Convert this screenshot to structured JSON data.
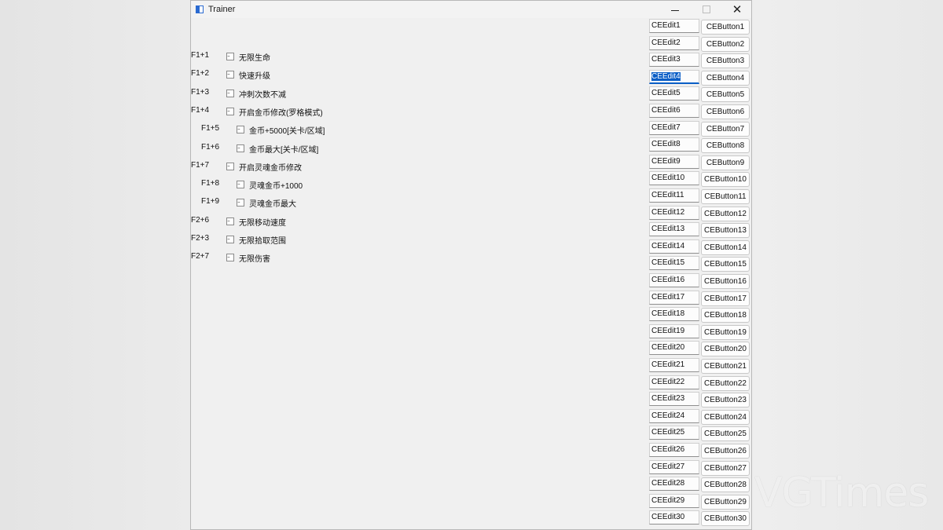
{
  "window": {
    "title": "Trainer",
    "controls": {
      "minimize": "—",
      "maximize": "☐",
      "close": "✕"
    }
  },
  "options": [
    {
      "hotkey": "F1+1",
      "label": "无限生命",
      "indent": false
    },
    {
      "hotkey": "F1+2",
      "label": "快速升级",
      "indent": false
    },
    {
      "hotkey": "F1+3",
      "label": "冲刺次数不减",
      "indent": false
    },
    {
      "hotkey": "F1+4",
      "label": "开启金币修改(罗格模式)",
      "indent": false
    },
    {
      "hotkey": "F1+5",
      "label": "金币+5000[关卡/区域]",
      "indent": true
    },
    {
      "hotkey": "F1+6",
      "label": "金币最大[关卡/区域]",
      "indent": true
    },
    {
      "hotkey": "F1+7",
      "label": "开启灵魂金币修改",
      "indent": false
    },
    {
      "hotkey": "F1+8",
      "label": "灵魂金币+1000",
      "indent": true
    },
    {
      "hotkey": "F1+9",
      "label": "灵魂金币最大",
      "indent": true
    },
    {
      "hotkey": "F2+6",
      "label": "无限移动速度",
      "indent": false
    },
    {
      "hotkey": "F2+3",
      "label": "无限拾取范围",
      "indent": false
    },
    {
      "hotkey": "F2+7",
      "label": "无限伤害",
      "indent": false
    }
  ],
  "edits": [
    "CEEdit1",
    "CEEdit2",
    "CEEdit3",
    "CEEdit4",
    "CEEdit5",
    "CEEdit6",
    "CEEdit7",
    "CEEdit8",
    "CEEdit9",
    "CEEdit10",
    "CEEdit11",
    "CEEdit12",
    "CEEdit13",
    "CEEdit14",
    "CEEdit15",
    "CEEdit16",
    "CEEdit17",
    "CEEdit18",
    "CEEdit19",
    "CEEdit20",
    "CEEdit21",
    "CEEdit22",
    "CEEdit23",
    "CEEdit24",
    "CEEdit25",
    "CEEdit26",
    "CEEdit27",
    "CEEdit28",
    "CEEdit29",
    "CEEdit30"
  ],
  "buttons": [
    "CEButton1",
    "CEButton2",
    "CEButton3",
    "CEButton4",
    "CEButton5",
    "CEButton6",
    "CEButton7",
    "CEButton8",
    "CEButton9",
    "CEButton10",
    "CEButton11",
    "CEButton12",
    "CEButton13",
    "CEButton14",
    "CEButton15",
    "CEButton16",
    "CEButton17",
    "CEButton18",
    "CEButton19",
    "CEButton20",
    "CEButton21",
    "CEButton22",
    "CEButton23",
    "CEButton24",
    "CEButton25",
    "CEButton26",
    "CEButton27",
    "CEButton28",
    "CEButton29",
    "CEButton30"
  ],
  "active_edit": "CEEdit4",
  "watermark": "VGTimes",
  "colors": {
    "selection": "#0a5ec6",
    "window_bg": "#f0f0f0"
  }
}
